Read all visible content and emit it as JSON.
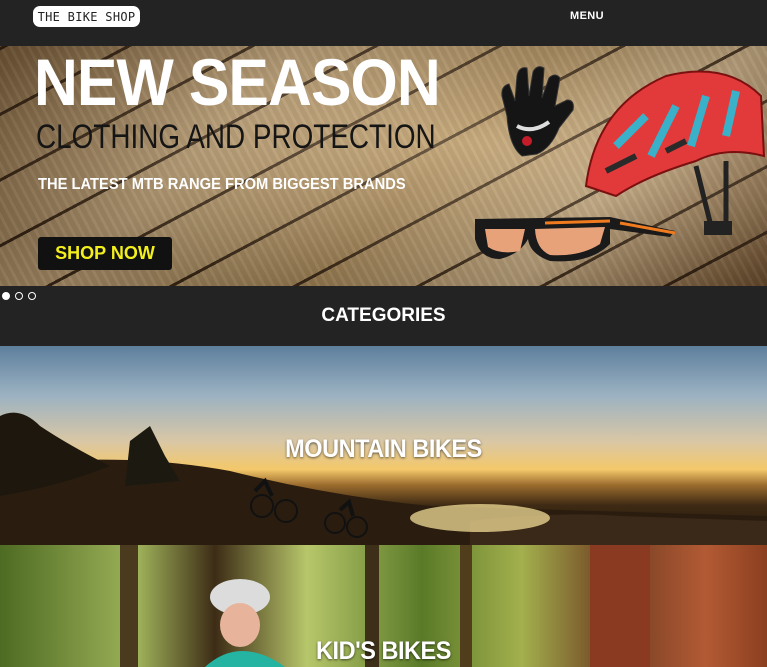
{
  "header": {
    "logo_text": "THE BIKE SHOP",
    "menu_label": "MENU"
  },
  "hero": {
    "title": "NEW SEASON",
    "subtitle": "CLOTHING AND PROTECTION",
    "tagline": "THE LATEST MTB RANGE FROM BIGGEST BRANDS",
    "cta_label": "SHOP NOW",
    "cta_color": "#f3ef1d",
    "slides": 3,
    "active_slide": 1
  },
  "categories": {
    "title": "CATEGORIES",
    "items": [
      {
        "label": "MOUNTAIN BIKES"
      },
      {
        "label": "KID'S BIKES"
      }
    ]
  }
}
